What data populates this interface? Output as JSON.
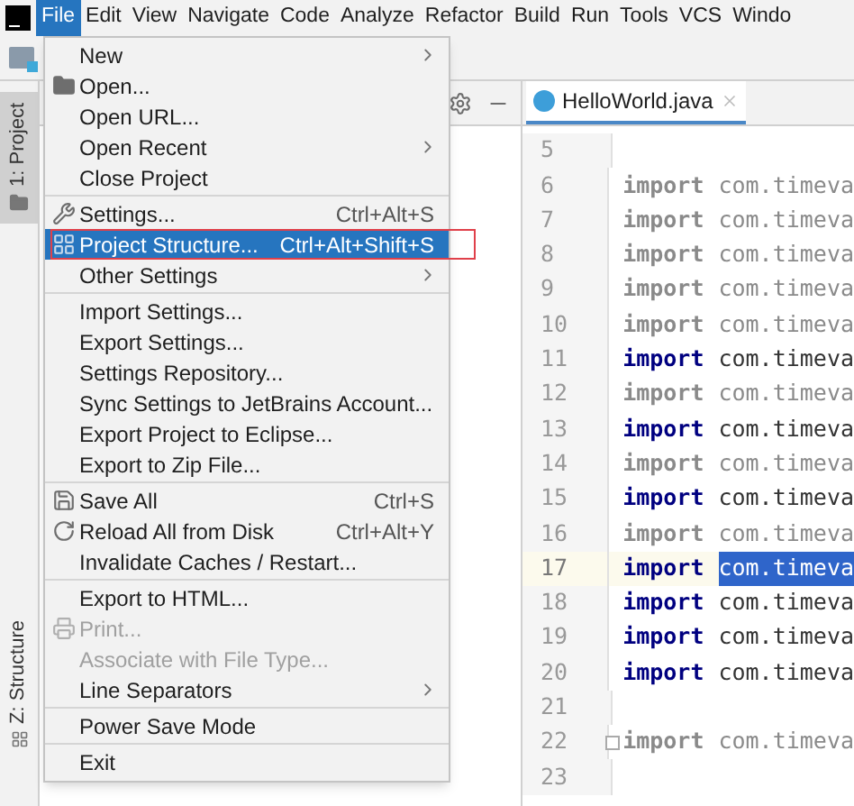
{
  "menubar": {
    "items": [
      {
        "label": "File",
        "selected": true
      },
      {
        "label": "Edit",
        "selected": false
      },
      {
        "label": "View",
        "selected": false
      },
      {
        "label": "Navigate",
        "selected": false
      },
      {
        "label": "Code",
        "selected": false
      },
      {
        "label": "Analyze",
        "selected": false
      },
      {
        "label": "Refactor",
        "selected": false
      },
      {
        "label": "Build",
        "selected": false
      },
      {
        "label": "Run",
        "selected": false
      },
      {
        "label": "Tools",
        "selected": false
      },
      {
        "label": "VCS",
        "selected": false
      },
      {
        "label": "Windo",
        "selected": false
      }
    ]
  },
  "side_tabs": [
    {
      "label": "1: Project",
      "selected": true,
      "kind": "project"
    },
    {
      "label": "Z: Structure",
      "selected": false,
      "kind": "structure"
    }
  ],
  "file_menu": [
    {
      "kind": "item",
      "label": "New",
      "submenu": true,
      "disabled": false,
      "selected": false,
      "boxed": false
    },
    {
      "kind": "open",
      "label": "Open...",
      "submenu": false,
      "disabled": false,
      "selected": false,
      "boxed": false
    },
    {
      "kind": "item",
      "label": "Open URL...",
      "submenu": false,
      "disabled": false,
      "selected": false,
      "boxed": false
    },
    {
      "kind": "item",
      "label": "Open Recent",
      "submenu": true,
      "disabled": false,
      "selected": false,
      "boxed": false
    },
    {
      "kind": "item",
      "label": "Close Project",
      "submenu": false,
      "disabled": false,
      "selected": false,
      "boxed": false
    },
    {
      "kind": "separator"
    },
    {
      "kind": "settings",
      "label": "Settings...",
      "shortcut": "Ctrl+Alt+S",
      "submenu": false,
      "disabled": false,
      "selected": false,
      "boxed": false
    },
    {
      "kind": "structure",
      "label": "Project Structure...",
      "shortcut": "Ctrl+Alt+Shift+S",
      "submenu": false,
      "disabled": false,
      "selected": true,
      "boxed": true
    },
    {
      "kind": "item",
      "label": "Other Settings",
      "submenu": true,
      "disabled": false,
      "selected": false,
      "boxed": false
    },
    {
      "kind": "separator"
    },
    {
      "kind": "item",
      "label": "Import Settings...",
      "submenu": false,
      "disabled": false,
      "selected": false,
      "boxed": false
    },
    {
      "kind": "item",
      "label": "Export Settings...",
      "submenu": false,
      "disabled": false,
      "selected": false,
      "boxed": false
    },
    {
      "kind": "item",
      "label": "Settings Repository...",
      "submenu": false,
      "disabled": false,
      "selected": false,
      "boxed": false
    },
    {
      "kind": "item",
      "label": "Sync Settings to JetBrains Account...",
      "submenu": false,
      "disabled": false,
      "selected": false,
      "boxed": false
    },
    {
      "kind": "item",
      "label": "Export Project to Eclipse...",
      "submenu": false,
      "disabled": false,
      "selected": false,
      "boxed": false
    },
    {
      "kind": "item",
      "label": "Export to Zip File...",
      "submenu": false,
      "disabled": false,
      "selected": false,
      "boxed": false
    },
    {
      "kind": "separator"
    },
    {
      "kind": "save",
      "label": "Save All",
      "shortcut": "Ctrl+S",
      "submenu": false,
      "disabled": false,
      "selected": false,
      "boxed": false
    },
    {
      "kind": "reload",
      "label": "Reload All from Disk",
      "shortcut": "Ctrl+Alt+Y",
      "submenu": false,
      "disabled": false,
      "selected": false,
      "boxed": false
    },
    {
      "kind": "item",
      "label": "Invalidate Caches / Restart...",
      "submenu": false,
      "disabled": false,
      "selected": false,
      "boxed": false
    },
    {
      "kind": "separator"
    },
    {
      "kind": "item",
      "label": "Export to HTML...",
      "submenu": false,
      "disabled": false,
      "selected": false,
      "boxed": false
    },
    {
      "kind": "print",
      "label": "Print...",
      "submenu": false,
      "disabled": true,
      "selected": false,
      "boxed": false
    },
    {
      "kind": "item",
      "label": "Associate with File Type...",
      "submenu": false,
      "disabled": true,
      "selected": false,
      "boxed": false
    },
    {
      "kind": "item",
      "label": "Line Separators",
      "submenu": true,
      "disabled": false,
      "selected": false,
      "boxed": false
    },
    {
      "kind": "separator"
    },
    {
      "kind": "item",
      "label": "Power Save Mode",
      "submenu": false,
      "disabled": false,
      "selected": false,
      "boxed": false
    },
    {
      "kind": "separator"
    },
    {
      "kind": "item",
      "label": "Exit",
      "submenu": false,
      "disabled": false,
      "selected": false,
      "boxed": false
    }
  ],
  "editor": {
    "tab": {
      "label": "HelloWorld.java",
      "selected": true
    },
    "lines": [
      {
        "number": "5",
        "kind": "blank",
        "current": false,
        "fold": false
      },
      {
        "number": "6",
        "kind": "import",
        "keyword": "import",
        "rest": "com.timeva",
        "used": false,
        "current": false,
        "fold": false
      },
      {
        "number": "7",
        "kind": "import",
        "keyword": "import",
        "rest": "com.timeva",
        "used": false,
        "current": false,
        "fold": false
      },
      {
        "number": "8",
        "kind": "import",
        "keyword": "import",
        "rest": "com.timeva",
        "used": false,
        "current": false,
        "fold": false
      },
      {
        "number": "9",
        "kind": "import",
        "keyword": "import",
        "rest": "com.timeva",
        "used": false,
        "current": false,
        "fold": false
      },
      {
        "number": "10",
        "kind": "import",
        "keyword": "import",
        "rest": "com.timeva",
        "used": false,
        "current": false,
        "fold": false
      },
      {
        "number": "11",
        "kind": "import",
        "keyword": "import",
        "rest": "com.timeva",
        "used": true,
        "current": false,
        "fold": false
      },
      {
        "number": "12",
        "kind": "import",
        "keyword": "import",
        "rest": "com.timeva",
        "used": false,
        "current": false,
        "fold": false
      },
      {
        "number": "13",
        "kind": "import",
        "keyword": "import",
        "rest": "com.timeva",
        "used": true,
        "current": false,
        "fold": false
      },
      {
        "number": "14",
        "kind": "import",
        "keyword": "import",
        "rest": "com.timeva",
        "used": false,
        "current": false,
        "fold": false
      },
      {
        "number": "15",
        "kind": "import",
        "keyword": "import",
        "rest": "com.timeva",
        "used": true,
        "current": false,
        "fold": false
      },
      {
        "number": "16",
        "kind": "import",
        "keyword": "import",
        "rest": "com.timeva",
        "used": false,
        "current": false,
        "fold": false
      },
      {
        "number": "17",
        "kind": "import",
        "keyword": "import",
        "rest": "com.timeva",
        "used": true,
        "current": true,
        "fold": false
      },
      {
        "number": "18",
        "kind": "import",
        "keyword": "import",
        "rest": "com.timeva",
        "used": true,
        "current": false,
        "fold": false
      },
      {
        "number": "19",
        "kind": "import",
        "keyword": "import",
        "rest": "com.timeva",
        "used": true,
        "current": false,
        "fold": false
      },
      {
        "number": "20",
        "kind": "import",
        "keyword": "import",
        "rest": "com.timeva",
        "used": true,
        "current": false,
        "fold": false
      },
      {
        "number": "21",
        "kind": "blank",
        "current": false,
        "fold": false
      },
      {
        "number": "22",
        "kind": "import",
        "keyword": "import",
        "rest": "com.timeva",
        "used": false,
        "current": false,
        "fold": true
      },
      {
        "number": "23",
        "kind": "blank",
        "current": false,
        "fold": false
      }
    ]
  }
}
